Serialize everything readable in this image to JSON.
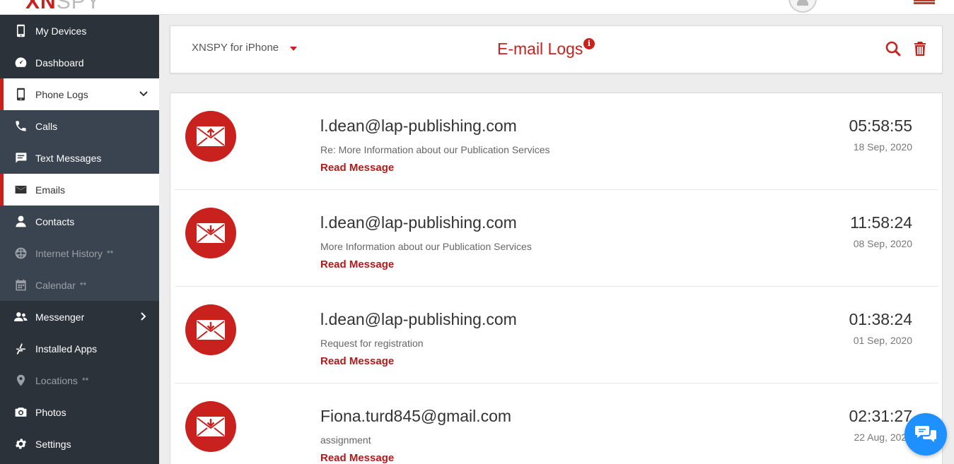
{
  "brand": {
    "logo_main": "XN",
    "logo_spy": "SPY"
  },
  "sidebar": {
    "items": [
      {
        "label": "My Devices",
        "icon": "phone-icon"
      },
      {
        "label": "Dashboard",
        "icon": "dashboard-icon"
      },
      {
        "label": "Phone Logs",
        "icon": "phone-icon"
      },
      {
        "label": "Calls",
        "icon": "call-icon"
      },
      {
        "label": "Text Messages",
        "icon": "message-icon"
      },
      {
        "label": "Emails",
        "icon": "envelope-icon"
      },
      {
        "label": "Contacts",
        "icon": "contact-icon"
      },
      {
        "label": "Internet History",
        "suffix": "**",
        "icon": "globe-icon"
      },
      {
        "label": "Calendar",
        "suffix": "**",
        "icon": "calendar-icon"
      },
      {
        "label": "Messenger",
        "icon": "users-icon"
      },
      {
        "label": "Installed Apps",
        "icon": "apps-icon"
      },
      {
        "label": "Locations",
        "suffix": "**",
        "icon": "map-pin-icon"
      },
      {
        "label": "Photos",
        "icon": "camera-icon"
      },
      {
        "label": "Settings",
        "icon": "gear-icon"
      }
    ]
  },
  "header": {
    "device": "XNSPY for iPhone",
    "title": "E-mail Logs",
    "info": "i"
  },
  "emails": [
    {
      "from": "l.dean@lap-publishing.com",
      "subject": "Re: More Information about our Publication Services",
      "link": "Read Message",
      "time": "05:58:55",
      "date": "18 Sep, 2020",
      "direction": "sent"
    },
    {
      "from": "l.dean@lap-publishing.com",
      "subject": "More Information about our Publication Services",
      "link": "Read Message",
      "time": "11:58:24",
      "date": "08 Sep, 2020",
      "direction": "received"
    },
    {
      "from": "l.dean@lap-publishing.com",
      "subject": "Request for registration",
      "link": "Read Message",
      "time": "01:38:24",
      "date": "01 Sep, 2020",
      "direction": "received"
    },
    {
      "from": "Fiona.turd845@gmail.com",
      "subject": "assignment",
      "link": "Read Message",
      "time": "02:31:27",
      "date": "22 Aug, 2020",
      "direction": "received"
    }
  ],
  "colors": {
    "accent": "#c9211e",
    "sidebar": "#2b323a",
    "sidebar_sub": "#3a4450",
    "chat": "#1e90ff"
  }
}
